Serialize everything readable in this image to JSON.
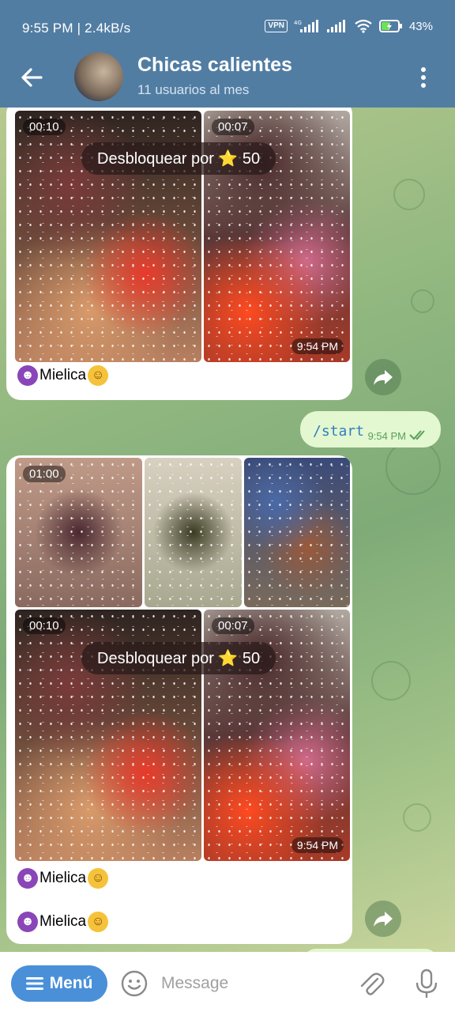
{
  "status_bar": {
    "time_speed": "9:55 PM | 2.4kB/s",
    "vpn": "VPN",
    "network": "4G",
    "battery": "43%"
  },
  "header": {
    "title": "Chicas calientes",
    "subtitle": "11 usuarios al mes"
  },
  "messages": {
    "first_post": {
      "videos": [
        {
          "duration": "00:10"
        },
        {
          "duration": "00:07",
          "time": "9:54 PM"
        }
      ],
      "unlock_label": "Desbloquear por ⭐ 50",
      "caption": "Mielica"
    },
    "outgoing": {
      "text": "/start",
      "time": "9:54 PM"
    },
    "second_post": {
      "top_videos": [
        {
          "duration": "01:00"
        }
      ],
      "videos": [
        {
          "duration": "00:10"
        },
        {
          "duration": "00:07",
          "time": "9:54 PM"
        }
      ],
      "unlock_label": "Desbloquear por ⭐ 50",
      "captions": [
        "Mielica",
        "Mielica"
      ]
    }
  },
  "input": {
    "menu_label": "Menú",
    "placeholder": "Message"
  },
  "colors": {
    "header": "#527da3",
    "menu_button": "#4a90d8",
    "outgoing_bubble": "#e3f7d0"
  }
}
